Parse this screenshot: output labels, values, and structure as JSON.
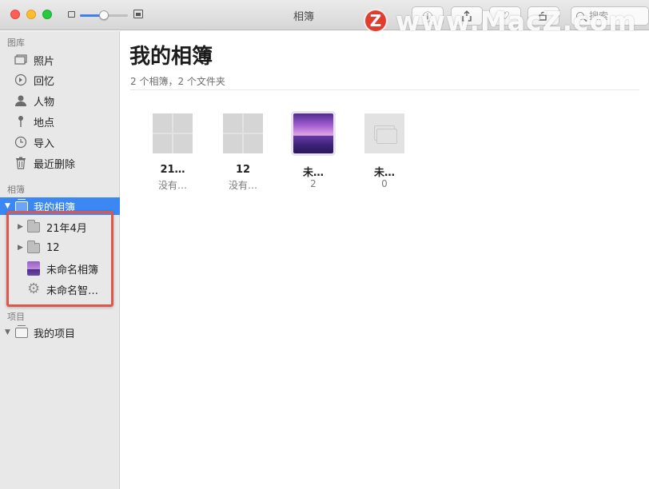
{
  "window": {
    "title": "相簿"
  },
  "toolbar": {
    "search_placeholder": "搜索",
    "info_icon": "info-icon",
    "share_icon": "share-icon",
    "heart_icon": "heart-icon",
    "rotate_icon": "rotate-icon"
  },
  "watermark": {
    "logo_letter": "Z",
    "text": "www.MacZ.com"
  },
  "sidebar": {
    "library_label": "图库",
    "library_items": [
      {
        "label": "照片",
        "icon": "photos-icon"
      },
      {
        "label": "回忆",
        "icon": "memories-icon"
      },
      {
        "label": "人物",
        "icon": "people-icon"
      },
      {
        "label": "地点",
        "icon": "places-icon"
      },
      {
        "label": "导入",
        "icon": "imports-icon"
      },
      {
        "label": "最近删除",
        "icon": "trash-icon"
      }
    ],
    "albums_label": "相簿",
    "my_albums": "我的相簿",
    "album_children": [
      {
        "label": "21年4月",
        "icon": "folder-icon"
      },
      {
        "label": "12",
        "icon": "folder-icon"
      },
      {
        "label": "未命名相簿",
        "icon": "album-thumbnail-icon"
      },
      {
        "label": "未命名智…",
        "icon": "smart-album-gear-icon"
      }
    ],
    "projects_label": "项目",
    "my_projects": "我的项目"
  },
  "main": {
    "title": "我的相簿",
    "subtitle": "2 个相簿，2 个文件夹",
    "tiles": [
      {
        "name": "21…",
        "sub": "没有…",
        "type": "folder"
      },
      {
        "name": "12",
        "sub": "没有…",
        "type": "folder"
      },
      {
        "name": "未…",
        "sub": "2",
        "type": "album"
      },
      {
        "name": "未…",
        "sub": "0",
        "type": "smart-album"
      }
    ]
  },
  "colors": {
    "selection": "#3b87f3",
    "highlight_box": "#e0564b",
    "sidebar_bg": "#e8e8e9"
  }
}
